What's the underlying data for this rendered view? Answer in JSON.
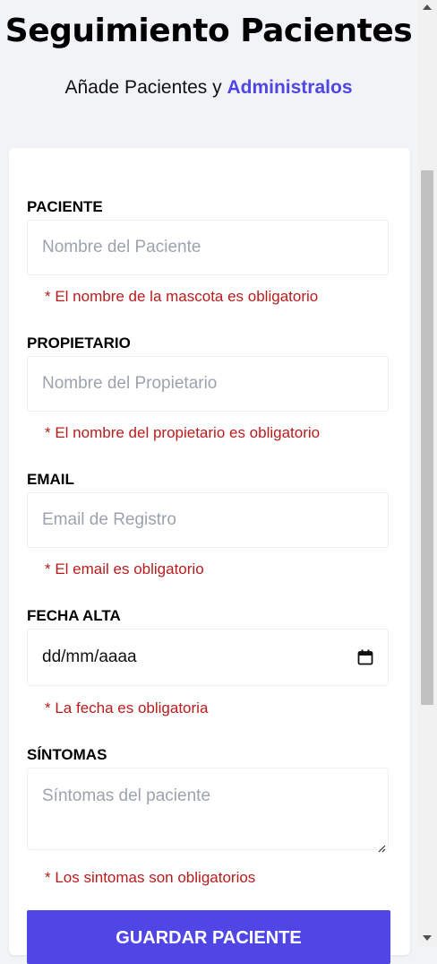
{
  "header": {
    "title": "Seguimiento Pacientes",
    "subtitle_prefix": "Añade Pacientes y",
    "subtitle_accent": "Administralos"
  },
  "form": {
    "patient": {
      "label": "PACIENTE",
      "placeholder": "Nombre del Paciente",
      "error": "* El nombre de la mascota es obligatorio"
    },
    "owner": {
      "label": "PROPIETARIO",
      "placeholder": "Nombre del Propietario",
      "error": "* El nombre del propietario es obligatorio"
    },
    "email": {
      "label": "EMAIL",
      "placeholder": "Email de Registro",
      "error": "* El email es obligatorio"
    },
    "date": {
      "label": "FECHA ALTA",
      "value": "dd/mm/aaaa",
      "error": "* La fecha es obligatoria"
    },
    "symptoms": {
      "label": "SÍNTOMAS",
      "placeholder": "Síntomas del paciente",
      "error": "* Los sintomas son obligatorios"
    },
    "submit_label": "GUARDAR PACIENTE"
  },
  "colors": {
    "accent": "#4f46e5",
    "error": "#b91c1c",
    "background": "#f1f3f7"
  },
  "icons": {
    "date_picker": "calendar-icon",
    "textarea_resize": "resize-handle-icon"
  }
}
